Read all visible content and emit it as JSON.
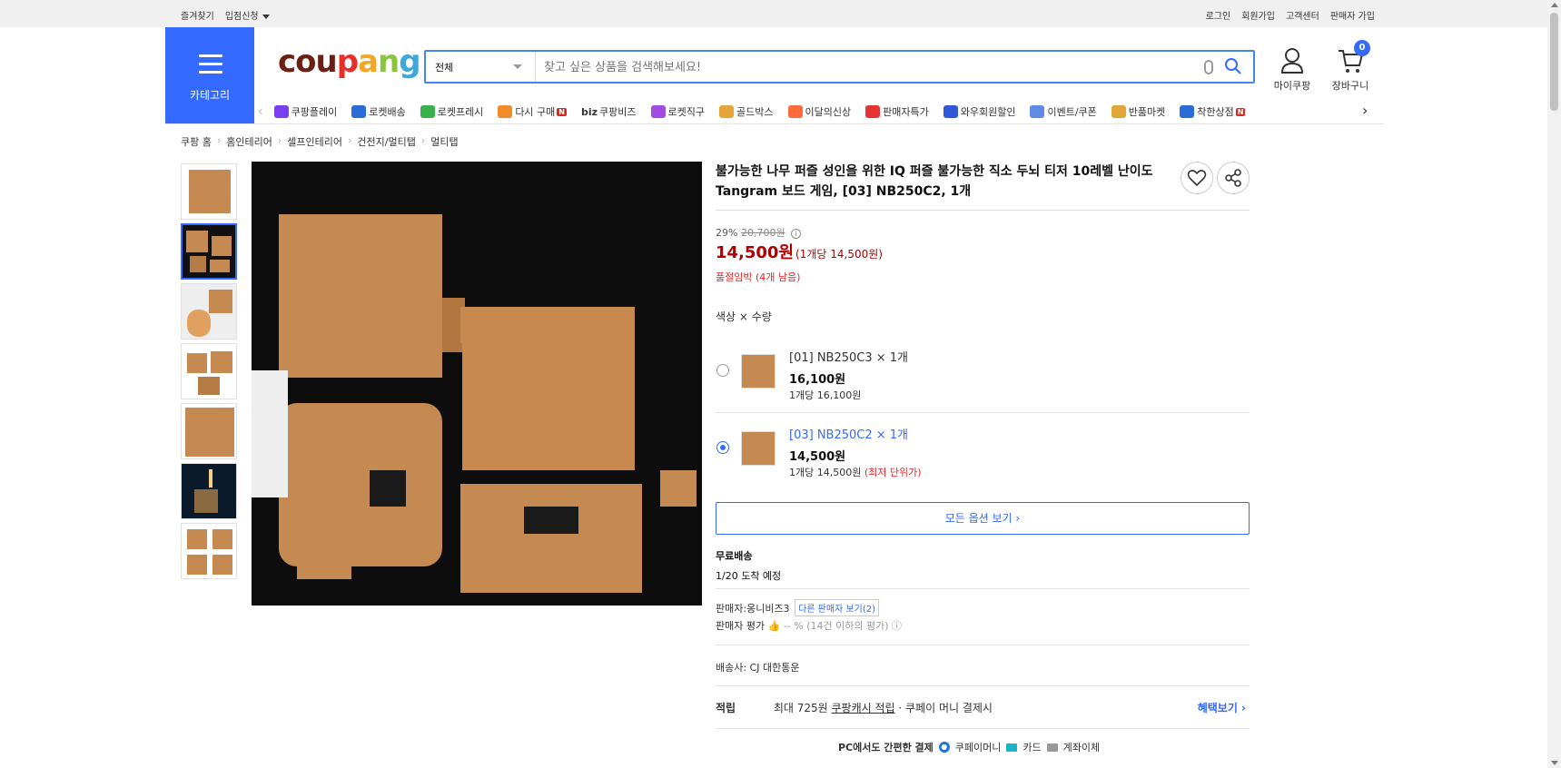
{
  "topbar": {
    "left": [
      "즐겨찾기",
      "입점신청"
    ],
    "right": [
      "로그인",
      "회원가입",
      "고객센터",
      "판매자 가입"
    ]
  },
  "header": {
    "category_label": "카테고리",
    "logo": [
      "cou",
      "p",
      "a",
      "n",
      "g"
    ],
    "search_category": "전체",
    "search_placeholder": "찾고 싶은 상품을 검색해보세요!",
    "mycoupang": "마이쿠팡",
    "cart": "장바구니",
    "cart_count": "0"
  },
  "shortcuts": [
    {
      "label": "쿠팡플레이",
      "color": "#7b3ff2",
      "new": false
    },
    {
      "label": "로켓배송",
      "color": "#2a6bd8",
      "new": false
    },
    {
      "label": "로켓프레시",
      "color": "#38b24a",
      "new": false
    },
    {
      "label": "다시 구매",
      "color": "#f08c2a",
      "new": true
    },
    {
      "label": "쿠팡비즈",
      "color": "#ffffff",
      "prefix": "biz",
      "new": false
    },
    {
      "label": "로켓직구",
      "color": "#a24be3",
      "new": false
    },
    {
      "label": "골드박스",
      "color": "#e6a53a",
      "new": false
    },
    {
      "label": "이달의신상",
      "color": "#ff6a3d",
      "new": false
    },
    {
      "label": "판매자특가",
      "color": "#e63434",
      "new": false
    },
    {
      "label": "와우회원할인",
      "color": "#2f59d9",
      "new": false
    },
    {
      "label": "이벤트/쿠폰",
      "color": "#5f8ae6",
      "new": false
    },
    {
      "label": "반품마켓",
      "color": "#e0a638",
      "new": false
    },
    {
      "label": "착한상점",
      "color": "#2a6bd8",
      "new": true
    }
  ],
  "new_badge": "N",
  "breadcrumb": [
    "쿠팡 홈",
    "홈인테리어",
    "셀프인테리어",
    "건전지/멀티탭",
    "멀티탭"
  ],
  "product": {
    "title": "불가능한 나무 퍼즐 성인을 위한 IQ 퍼즐 불가능한 직소 두뇌 티저 10레벨 난이도 Tangram 보드 게임, [03] NB250C2, 1개",
    "discount_rate": "29%",
    "original_price": "20,700원",
    "info_icon": "i",
    "price": "14,500원",
    "unit_price": "(1개당 14,500원)",
    "stock_warning": "품절임박 (4개 남음)",
    "option_header": "색상 × 수량",
    "options": [
      {
        "name": "[01] NB250C3 × 1개",
        "price": "16,100원",
        "unit": "1개당 16,100원",
        "best": "",
        "selected": false
      },
      {
        "name": "[03] NB250C2 × 1개",
        "price": "14,500원",
        "unit": "1개당 14,500원",
        "best": "(최저 단위가)",
        "selected": true
      }
    ],
    "all_options": "모든 옵션 보기 ›",
    "shipping_type": "무료배송",
    "arrival": "1/20 도착 예정",
    "seller_label": "판매자:",
    "seller_name": "옹니비즈3",
    "other_sellers": "다른 판매자 보기(2)",
    "seller_rating_label": "판매자 평가",
    "seller_rating_value": "-- % (14건 이하의 평가)",
    "carrier": "배송사:  CJ 대한통운",
    "reward_label": "적립",
    "reward_text": "최대 725원",
    "reward_link": "쿠팡캐시 적립",
    "reward_suffix": " · 쿠페이 머니 결제시",
    "benefit_link": "혜택보기 ›",
    "pay_label": "PC에서도 간편한 결제",
    "pay_methods": [
      "쿠페이머니",
      "카드",
      "계좌이체"
    ]
  }
}
